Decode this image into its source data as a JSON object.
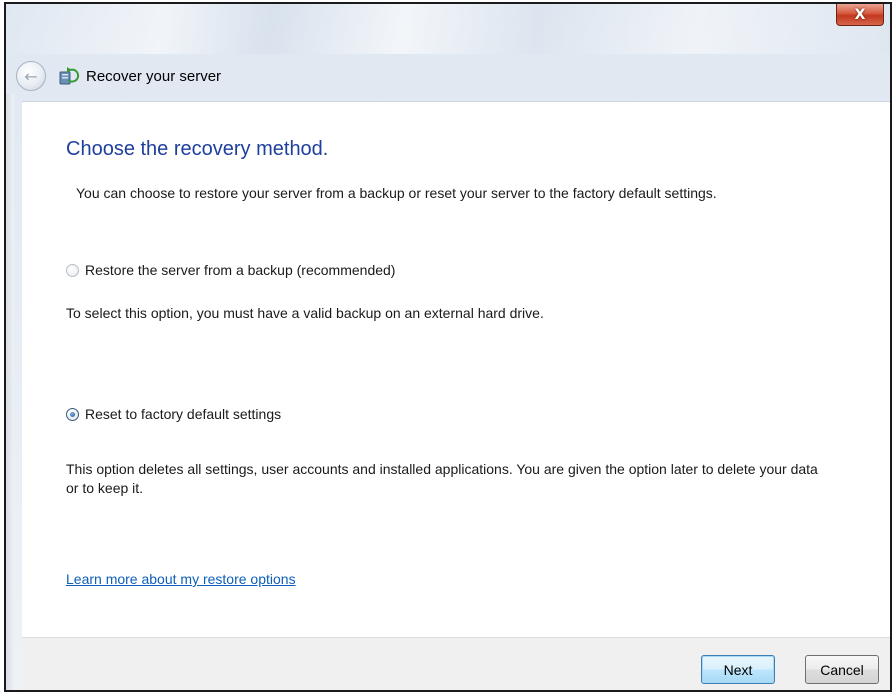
{
  "window": {
    "title": "Recover your server",
    "close_glyph": "X"
  },
  "nav": {
    "back_icon": "back-arrow-icon",
    "back_glyph": "←",
    "wizard_icon": "server-recovery-icon"
  },
  "page": {
    "heading": "Choose the recovery method.",
    "intro": "You can choose to restore your server from a backup or reset your server to the factory default settings."
  },
  "options": [
    {
      "label": "Restore the server from a backup (recommended)",
      "selected": false,
      "enabled": false,
      "description": "To select this option, you must have a valid backup on an external hard drive."
    },
    {
      "label": "Reset to factory default settings",
      "selected": true,
      "enabled": true,
      "description": "This option deletes all settings, user accounts and installed applications. You are given the option later to delete your data or to keep it."
    }
  ],
  "help_link": "Learn more about my restore options",
  "footer": {
    "next_label": "Next",
    "cancel_label": "Cancel"
  },
  "colors": {
    "heading": "#1e3f9e",
    "link": "#0e5fb7",
    "close_button": "#c2381e"
  }
}
